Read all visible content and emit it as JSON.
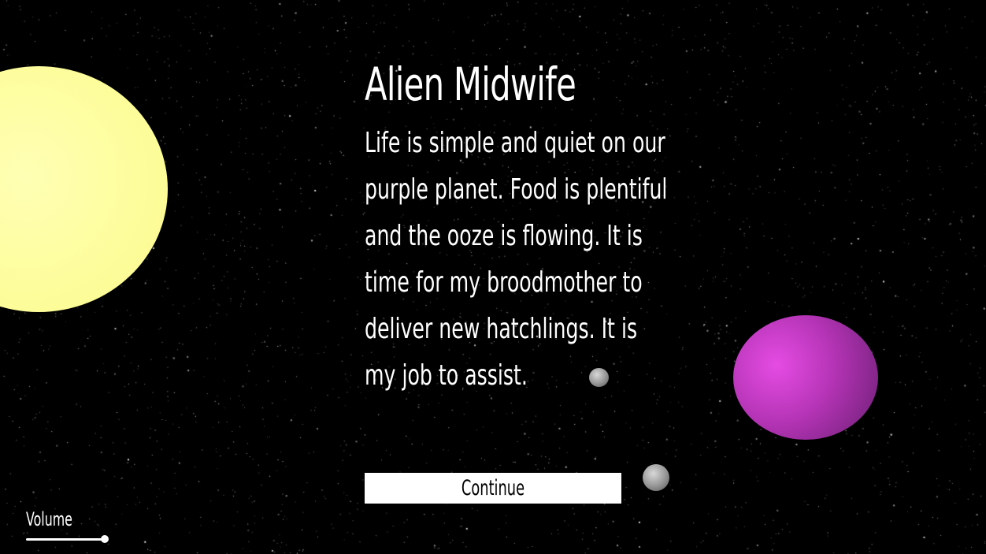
{
  "story": {
    "title": "Alien Midwife",
    "lines": [
      "Life is simple and quiet on our",
      "purple planet. Food is plentiful",
      "and the ooze is flowing. It is",
      "time for my broodmother to",
      "deliver new hatchlings. It is",
      "my job to assist."
    ],
    "continue_label": "Continue"
  },
  "settings": {
    "volume_label": "Volume",
    "volume_level": 1.0
  },
  "colors": {
    "background": "#000000",
    "sun": "#fdfd9c",
    "purple_planet": "#b534b6",
    "text": "#ffffff",
    "button_bg": "#ffffff",
    "button_text": "#000000"
  }
}
